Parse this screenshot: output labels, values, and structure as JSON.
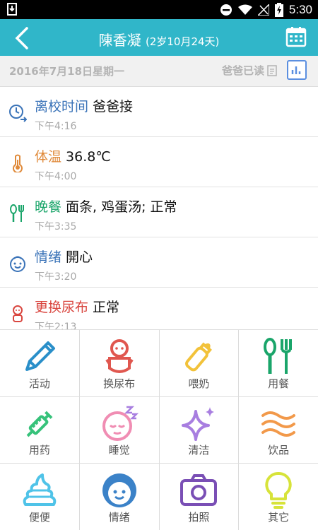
{
  "status_bar": {
    "time": "5:30"
  },
  "header": {
    "name": "陳香凝",
    "age": "(2岁10月24天)"
  },
  "date_bar": {
    "date": "2016年7月18日星期一",
    "read_status": "爸爸已读"
  },
  "records": [
    {
      "category": "离校时间",
      "detail": "爸爸接",
      "time": "下午4:16",
      "color": "#3a73b8",
      "icon": "clock-arrow-icon"
    },
    {
      "category": "体温",
      "detail": "36.8℃",
      "time": "下午4:00",
      "color": "#e08a3a",
      "icon": "thermometer-icon"
    },
    {
      "category": "晚餐",
      "detail": "面条, 鸡蛋汤; 正常",
      "time": "下午3:35",
      "color": "#1aa56a",
      "icon": "fork-spoon-icon"
    },
    {
      "category": "情绪",
      "detail": "開心",
      "time": "下午3:20",
      "color": "#3a73b8",
      "icon": "smiley-face-icon"
    },
    {
      "category": "更换尿布",
      "detail": "正常",
      "time": "下午2:13",
      "color": "#d9463f",
      "icon": "baby-icon"
    }
  ],
  "actions": [
    {
      "label": "活动",
      "icon": "pencil-icon",
      "color": "#2a8fc9"
    },
    {
      "label": "换尿布",
      "icon": "baby-diaper-icon",
      "color": "#e0574f"
    },
    {
      "label": "喂奶",
      "icon": "baby-bottle-icon",
      "color": "#f2c23a"
    },
    {
      "label": "用餐",
      "icon": "fork-spoon-icon",
      "color": "#1aa56a"
    },
    {
      "label": "用药",
      "icon": "syringe-icon",
      "color": "#36c27a"
    },
    {
      "label": "睡觉",
      "icon": "sleeping-face-icon",
      "color": "#f08db3"
    },
    {
      "label": "清洁",
      "icon": "sparkle-icon",
      "color": "#a87ee0"
    },
    {
      "label": "饮品",
      "icon": "waves-icon",
      "color": "#f2994a"
    },
    {
      "label": "便便",
      "icon": "poop-icon",
      "color": "#4fc3e8"
    },
    {
      "label": "情绪",
      "icon": "happy-face-icon",
      "color": "#3b82c8"
    },
    {
      "label": "拍照",
      "icon": "camera-icon",
      "color": "#7a4fb5"
    },
    {
      "label": "其它",
      "icon": "lightbulb-icon",
      "color": "#d7e33a"
    }
  ]
}
